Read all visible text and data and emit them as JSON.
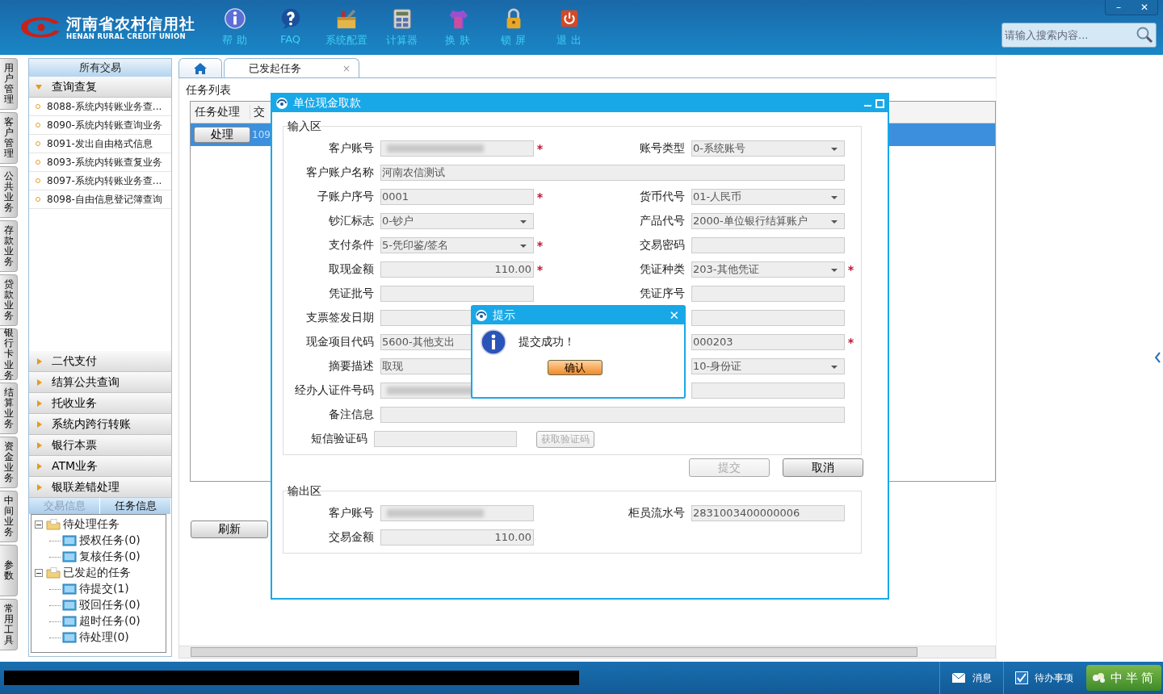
{
  "app": {
    "logo_cn": "河南省农村信用社",
    "logo_en": "HENAN RURAL CREDIT UNION",
    "window_buttons": [
      "–",
      "✕"
    ]
  },
  "toolbar": [
    {
      "label": "帮 助",
      "kind": "info"
    },
    {
      "label": "FAQ",
      "kind": "faq"
    },
    {
      "label": "系统配置",
      "kind": "config"
    },
    {
      "label": "计算器",
      "kind": "calc"
    },
    {
      "label": "换 肤",
      "kind": "skin"
    },
    {
      "label": "锁 屏",
      "kind": "lock"
    },
    {
      "label": "退 出",
      "kind": "exit"
    }
  ],
  "search": {
    "placeholder": "请输入搜索内容..."
  },
  "side_tabs": [
    "用户管理",
    "客户管理",
    "公共业务",
    "存款业务",
    "贷款业务",
    "银行卡业务",
    "结算业务",
    "资金业务",
    "中间业务",
    "参数",
    "常用工具"
  ],
  "sidebar": {
    "title": "所有交易",
    "groups": [
      {
        "label": "查询查复",
        "expanded": true,
        "items": [
          "8088-系统内转账业务查...",
          "8090-系统内转账查询业务",
          "8091-发出自由格式信息",
          "8093-系统内转账查复业务",
          "8097-系统内转账业务查...",
          "8098-自由信息登记簿查询"
        ]
      },
      {
        "label": "二代支付",
        "expanded": false
      },
      {
        "label": "结算公共查询",
        "expanded": false
      },
      {
        "label": "托收业务",
        "expanded": false
      },
      {
        "label": "系统内跨行转账",
        "expanded": false
      },
      {
        "label": "银行本票",
        "expanded": false
      },
      {
        "label": "ATM业务",
        "expanded": false
      },
      {
        "label": "银联差错处理",
        "expanded": false
      }
    ],
    "panel_tabs": [
      {
        "label": "交易信息",
        "selected": false
      },
      {
        "label": "任务信息",
        "selected": true
      }
    ],
    "tree": [
      {
        "label": "待处理任务",
        "expanded": true,
        "children": [
          {
            "label": "授权任务(0)"
          },
          {
            "label": "复核任务(0)"
          }
        ]
      },
      {
        "label": "已发起的任务",
        "expanded": true,
        "children": [
          {
            "label": "待提交(1)"
          },
          {
            "label": "驳回任务(0)"
          },
          {
            "label": "超时任务(0)"
          },
          {
            "label": "待处理(0)"
          }
        ]
      }
    ]
  },
  "tabs": [
    {
      "kind": "home",
      "selected": false
    },
    {
      "kind": "page",
      "label": "已发起任务",
      "selected": true,
      "close": "×"
    }
  ],
  "task_list": {
    "title": "任务列表",
    "columns": [
      "任务处理",
      "交"
    ],
    "rows": [
      {
        "cells": [
          "处理",
          "109"
        ],
        "selected": true
      }
    ],
    "refresh": "刷新"
  },
  "form_dialog": {
    "title": "单位现金取款",
    "input_section": "输入区",
    "rows": [
      {
        "left": {
          "label": "客户账号",
          "kind": "text",
          "redacted": true,
          "required": true
        },
        "right": {
          "label": "账号类型",
          "kind": "select",
          "value": "0-系统账号"
        }
      },
      {
        "full": {
          "label": "客户账户名称",
          "value": "河南农信测试"
        }
      },
      {
        "left": {
          "label": "子账户序号",
          "kind": "text",
          "value": "0001",
          "required": true
        },
        "right": {
          "label": "货币代号",
          "kind": "select",
          "value": "01-人民币"
        }
      },
      {
        "left": {
          "label": "钞汇标志",
          "kind": "select",
          "value": "0-钞户"
        },
        "right": {
          "label": "产品代号",
          "kind": "select",
          "value": "2000-单位银行结算账户"
        }
      },
      {
        "left": {
          "label": "支付条件",
          "kind": "select",
          "value": "5-凭印鉴/签名",
          "required": true
        },
        "right": {
          "label": "交易密码",
          "kind": "text"
        }
      },
      {
        "left": {
          "label": "取现金额",
          "kind": "amount",
          "value": "110.00",
          "required": true
        },
        "right": {
          "label": "凭证种类",
          "kind": "select",
          "value": "203-其他凭证",
          "required": true
        }
      },
      {
        "left": {
          "label": "凭证批号",
          "kind": "text"
        },
        "right": {
          "label": "凭证序号",
          "kind": "text"
        }
      },
      {
        "left": {
          "label": "支票签发日期",
          "kind": "text"
        },
        "right": {
          "kind": "text"
        }
      },
      {
        "left": {
          "label": "现金项目代码",
          "kind": "text",
          "value": "5600-其他支出"
        },
        "right": {
          "kind": "text",
          "value": "000203",
          "required": true
        }
      },
      {
        "left": {
          "label": "摘要描述",
          "kind": "text",
          "value": "取现"
        },
        "right": {
          "kind": "select",
          "value": "10-身份证"
        }
      },
      {
        "left": {
          "label": "经办人证件号码",
          "kind": "text",
          "redacted": true
        },
        "right": {
          "kind": "text"
        }
      },
      {
        "full": {
          "label": "备注信息"
        }
      },
      {
        "left": {
          "label": "短信验证码",
          "kind": "text"
        },
        "button": {
          "label": "获取验证码",
          "disabled": true
        }
      }
    ],
    "buttons": [
      {
        "label": "提交",
        "disabled": true
      },
      {
        "label": "取消",
        "disabled": false
      }
    ],
    "output_section": "输出区",
    "output_rows": [
      {
        "left": {
          "label": "客户账号",
          "kind": "text",
          "redacted": true
        },
        "right": {
          "label": "柜员流水号",
          "value": "2831003400000006"
        }
      },
      {
        "left": {
          "label": "交易金额",
          "kind": "amount",
          "value": "110.00"
        }
      }
    ]
  },
  "alert": {
    "title": "提示",
    "message": "提交成功！",
    "button": "确认",
    "close": "✕"
  },
  "status_bar": {
    "items": [
      {
        "label": "消息",
        "kind": "message"
      },
      {
        "label": "待办事项",
        "kind": "todo",
        "checked": true
      }
    ],
    "ime": [
      "中",
      "半",
      "简"
    ]
  }
}
